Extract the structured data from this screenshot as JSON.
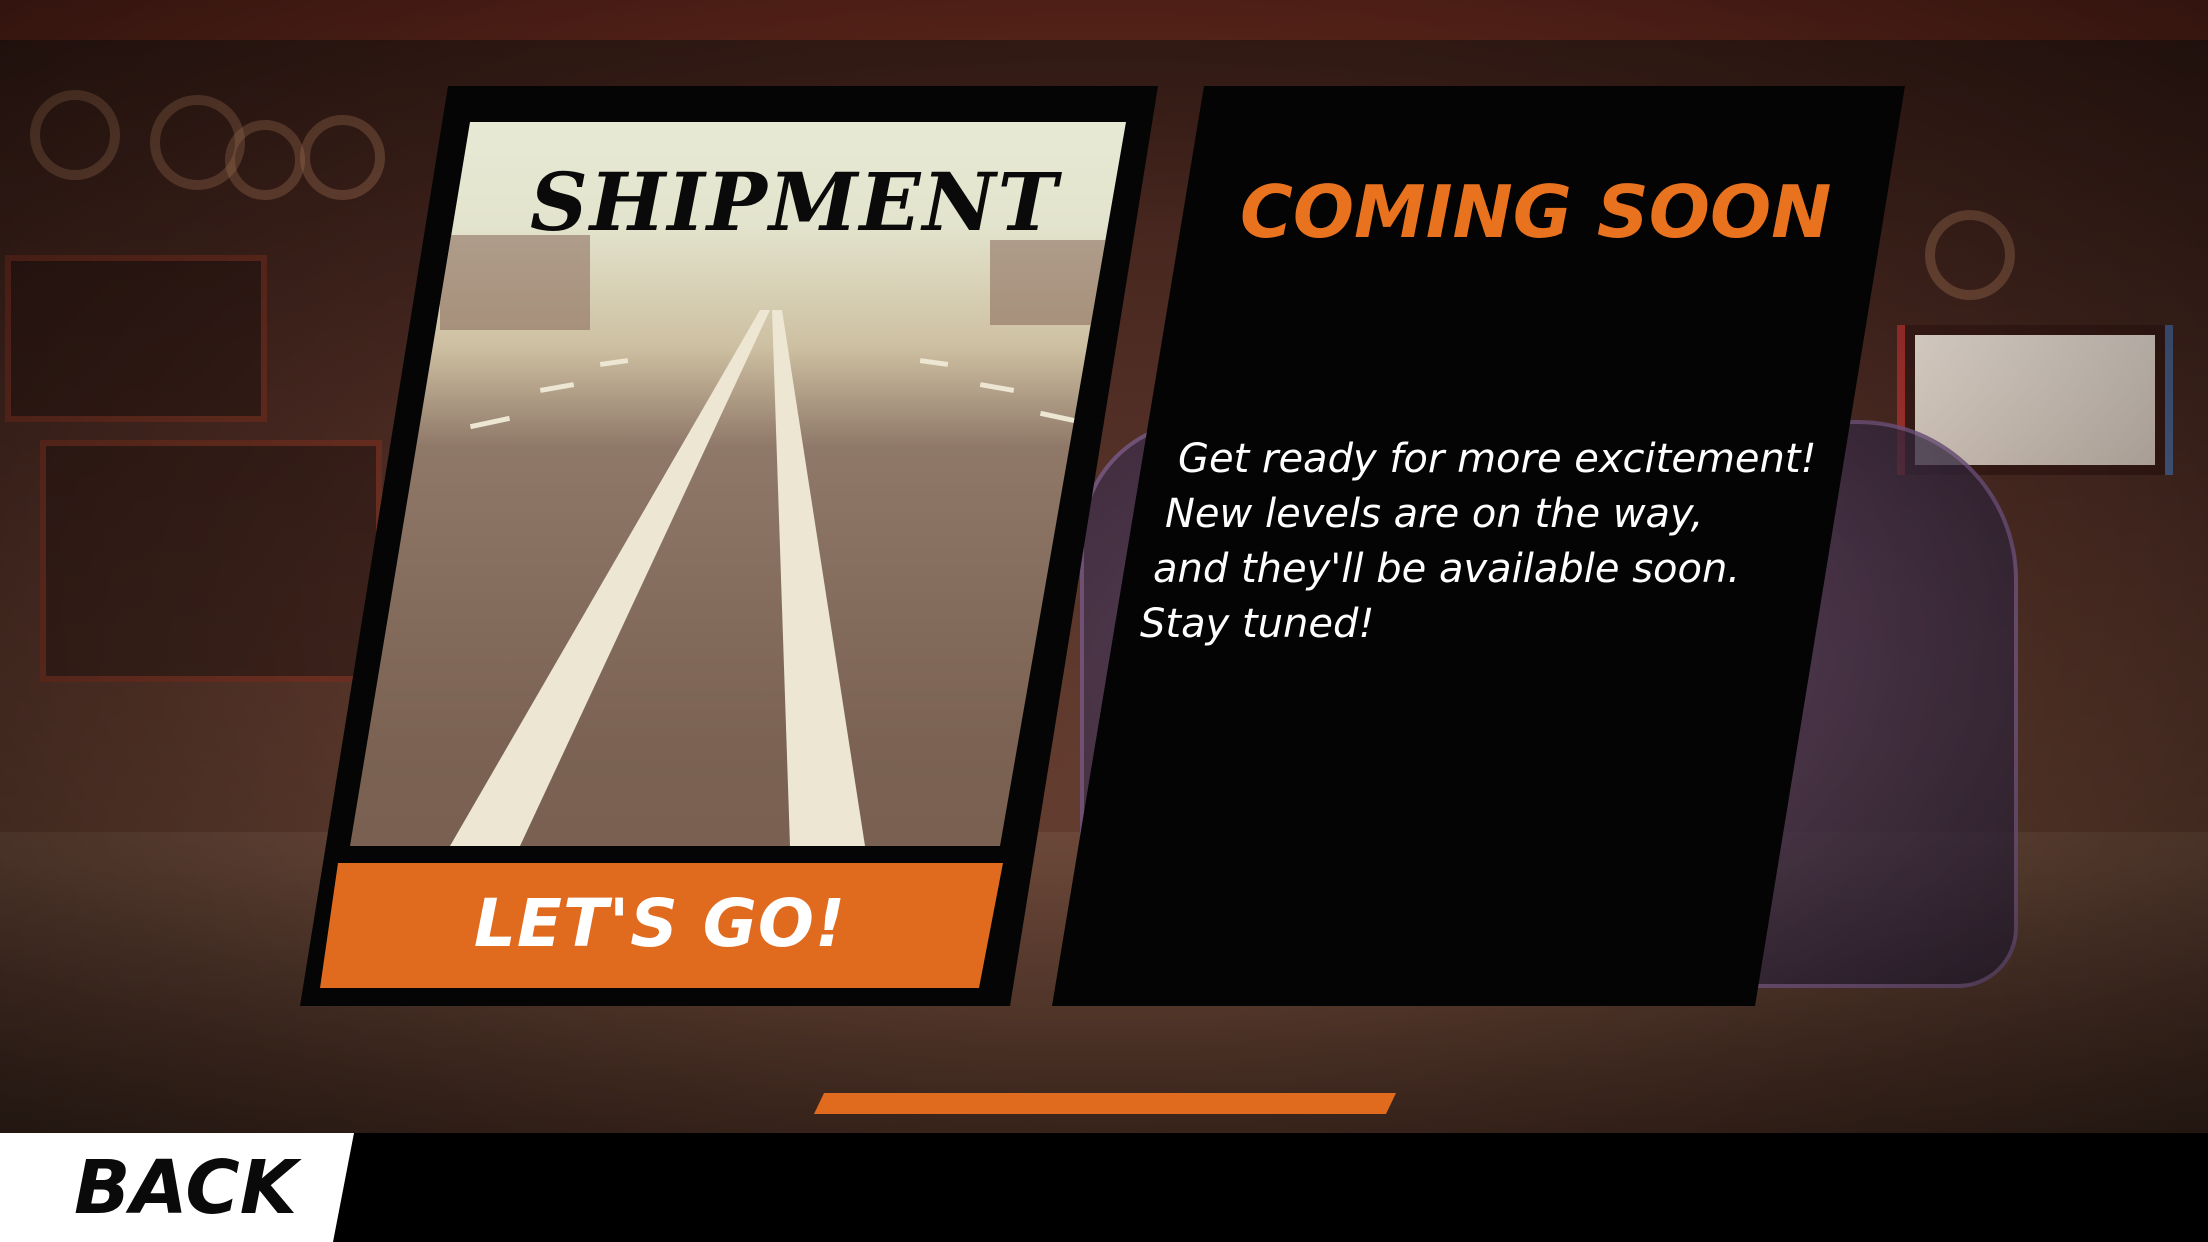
{
  "level_card": {
    "title": "SHIPMENT",
    "play_label": "LET'S GO!"
  },
  "coming_soon": {
    "title": "COMING SOON",
    "lines": [
      "Get ready for more excitement!",
      "New levels are on the way,",
      "and they'll be available soon.",
      "Stay tuned!"
    ]
  },
  "footer": {
    "back_label": "BACK"
  },
  "colors": {
    "accent_orange": "#e06b1e",
    "panel_black": "#050505",
    "text_white": "#ffffff"
  },
  "icons": [
    "road-preview-image"
  ]
}
